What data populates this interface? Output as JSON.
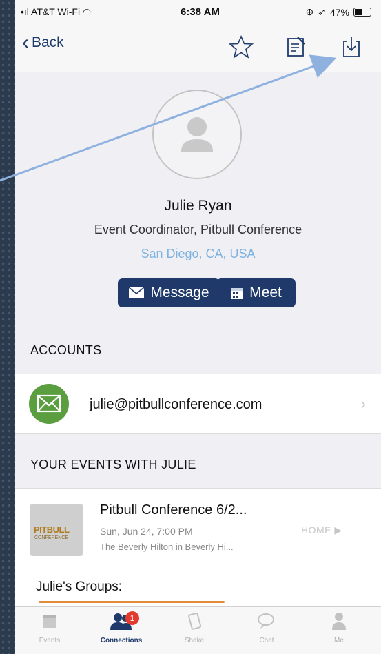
{
  "status_bar": {
    "carrier": "AT&T Wi-Fi",
    "time": "6:38 AM",
    "battery": "47%"
  },
  "nav": {
    "back_label": "Back",
    "icons": [
      "star-icon",
      "notes-icon",
      "download-contact-icon"
    ]
  },
  "profile": {
    "name": "Julie Ryan",
    "title": "Event Coordinator, Pitbull Conference",
    "location": "San Diego, CA, USA",
    "message_label": "Message",
    "meet_label": "Meet"
  },
  "accounts": {
    "header": "ACCOUNTS",
    "email": "julie@pitbullconference.com"
  },
  "events": {
    "header": "YOUR EVENTS WITH JULIE",
    "item": {
      "name": "Pitbull Conference 6/2...",
      "date": "Sun, Jun 24, 7:00 PM",
      "venue": "The Beverly Hilton in Beverly Hi...",
      "home_label": "HOME",
      "thumb_line1": "PITBULL",
      "thumb_line2": "CONFERENCE"
    },
    "groups_label": "Julie's Groups:"
  },
  "tabbar": {
    "tabs": [
      {
        "label": "Events",
        "icon": "calendar-icon"
      },
      {
        "label": "Connections",
        "icon": "people-icon",
        "badge": "1"
      },
      {
        "label": "Shake",
        "icon": "phone-shake-icon"
      },
      {
        "label": "Chat",
        "icon": "chat-bubble-icon"
      },
      {
        "label": "Me",
        "icon": "person-icon"
      }
    ]
  },
  "colors": {
    "accent": "#1f3a6a",
    "location": "#7fb3df",
    "email_icon_bg": "#5b9e3f",
    "badge": "#e23b2e",
    "annotation_arrow": "#8fb1e0"
  }
}
